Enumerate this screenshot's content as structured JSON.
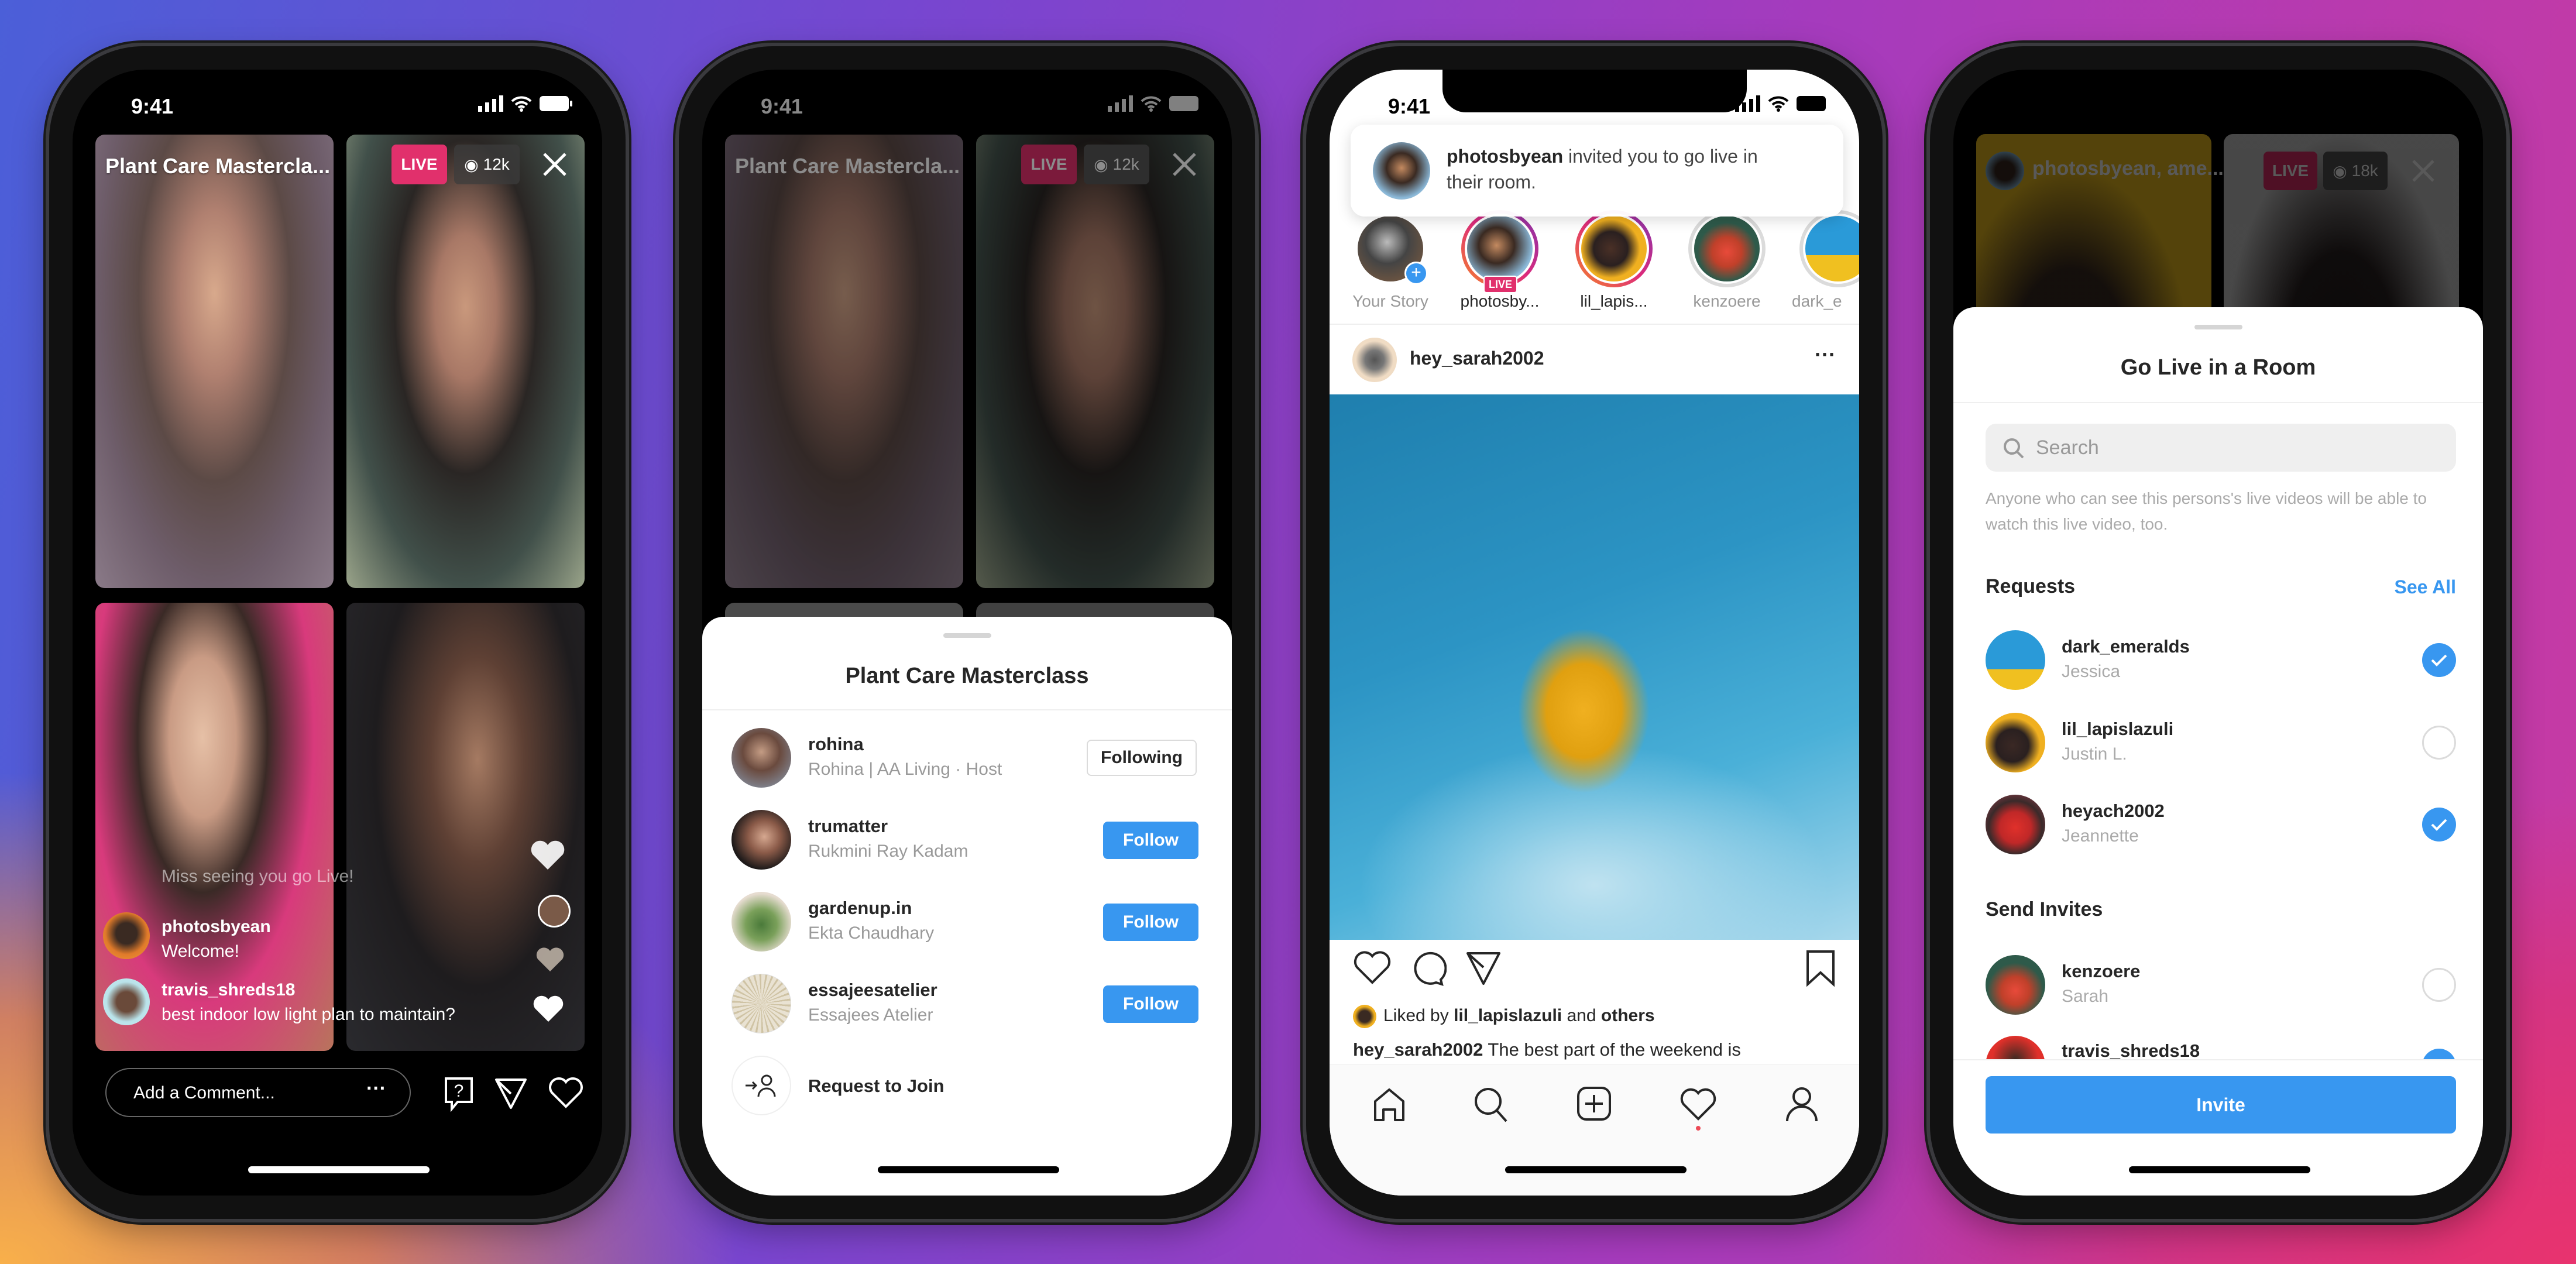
{
  "status_time": "9:41",
  "live_room": {
    "title": "Plant Care Mastercla...",
    "live_badge": "LIVE",
    "viewers": "12k",
    "comments": [
      {
        "user": "",
        "text": "Miss seeing you go Live!"
      },
      {
        "user": "photosbyean",
        "text": "Welcome!"
      },
      {
        "user": "travis_shreds18",
        "text": "best indoor low light plan to maintain?"
      }
    ],
    "comment_placeholder": "Add a Comment..."
  },
  "room_sheet": {
    "title": "Plant Care Masterclass",
    "participants": [
      {
        "username": "rohina",
        "subtitle": "Rohina | AA Living · Host",
        "button": "Following"
      },
      {
        "username": "trumatter",
        "subtitle": "Rukmini Ray Kadam",
        "button": "Follow"
      },
      {
        "username": "gardenup.in",
        "subtitle": "Ekta Chaudhary",
        "button": "Follow"
      },
      {
        "username": "essajeesatelier",
        "subtitle": "Essajees Atelier",
        "button": "Follow"
      }
    ],
    "request_label": "Request to Join"
  },
  "feed": {
    "notification": {
      "user": "photosbyean",
      "text": " invited you to go live in their room."
    },
    "stories": [
      {
        "label": "Your Story"
      },
      {
        "label": "photosby...",
        "live": "LIVE"
      },
      {
        "label": "lil_lapis..."
      },
      {
        "label": "kenzoere"
      },
      {
        "label": "dark_e"
      }
    ],
    "post_user": "hey_sarah2002",
    "liked_prefix": "Liked by ",
    "liked_user": "lil_lapislazuli",
    "liked_mid": " and ",
    "liked_others": "others",
    "caption_user": "hey_sarah2002",
    "caption_text": " The best part of the weekend is"
  },
  "invite_sheet": {
    "header_title": "photosbyean, ame...",
    "live_badge": "LIVE",
    "viewers": "18k",
    "title": "Go Live in a Room",
    "search_placeholder": "Search",
    "info": "Anyone who can see this persons's live videos will be able to watch this live video, too.",
    "requests_label": "Requests",
    "see_all": "See All",
    "requests": [
      {
        "username": "dark_emeralds",
        "name": "Jessica",
        "checked": true
      },
      {
        "username": "lil_lapislazuli",
        "name": "Justin L.",
        "checked": false
      },
      {
        "username": "heyach2002",
        "name": "Jeannette",
        "checked": true
      }
    ],
    "invites_label": "Send Invites",
    "invites": [
      {
        "username": "kenzoere",
        "name": "Sarah",
        "checked": false
      },
      {
        "username": "travis_shreds18",
        "name": "",
        "checked": true
      }
    ],
    "invite_button": "Invite"
  },
  "colors": {
    "accent": "#3897f0",
    "live": "#e1306c"
  }
}
